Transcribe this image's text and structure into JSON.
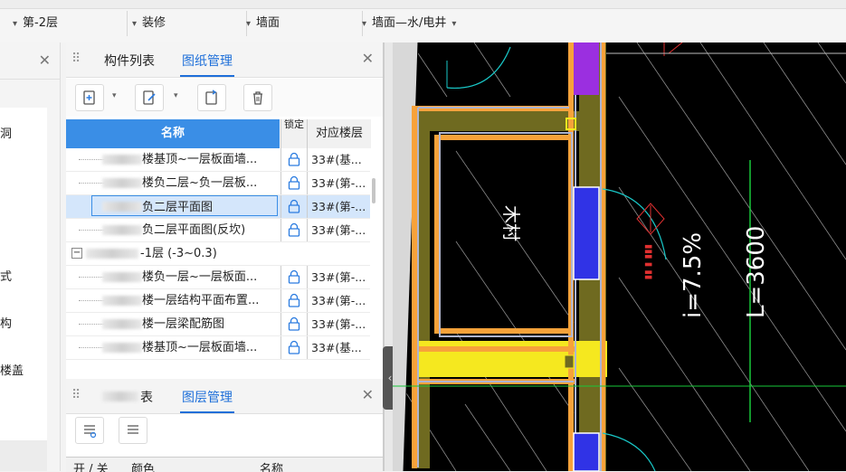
{
  "toolbar": {
    "combos": [
      {
        "label": "第-2层"
      },
      {
        "label": "装修"
      },
      {
        "label": "墙面"
      },
      {
        "label": "墙面—水/电井"
      }
    ]
  },
  "left_panel": {
    "items": [
      "洞",
      "式",
      "构",
      "楼盖"
    ]
  },
  "drawing_panel": {
    "tabs": [
      "构件列表",
      "图纸管理"
    ],
    "active_tab": "图纸管理",
    "table": {
      "headers": {
        "name": "名称",
        "lock": "锁定",
        "floor": "对应楼层"
      },
      "rows": [
        {
          "name": "楼基顶~一层板面墙...",
          "floor": "33#(基...",
          "selected": false
        },
        {
          "name": "楼负二层~负一层板...",
          "floor": "33#(第-...",
          "selected": false
        },
        {
          "name": "负二层平面图",
          "floor": "33#(第-...",
          "selected": true
        },
        {
          "name": "负二层平面图(反坎)",
          "floor": "33#(第-...",
          "selected": false
        },
        {
          "name": "-1层 (-3~0.3)",
          "floor": "",
          "group": true
        },
        {
          "name": "楼负一层~一层板面...",
          "floor": "33#(第-...",
          "selected": false
        },
        {
          "name": "楼一层结构平面布置...",
          "floor": "33#(第-...",
          "selected": false
        },
        {
          "name": "楼一层梁配筋图",
          "floor": "33#(第-...",
          "selected": false
        },
        {
          "name": "楼基顶~一层板面墙...",
          "floor": "33#(基...",
          "selected": false
        }
      ]
    }
  },
  "layer_panel": {
    "tabs": [
      "表",
      "图层管理"
    ],
    "active_tab": "图层管理",
    "headers": {
      "onoff": "开 / 关",
      "color": "颜色",
      "name": "名称"
    }
  },
  "cad": {
    "labels": {
      "material": "木村",
      "slope": "i=7.5%",
      "length": "L=3600"
    },
    "colors": {
      "wall": "#f7a23a",
      "fill": "#6f6a20",
      "door": "#3033e6",
      "purple": "#9b2fe0",
      "yellow": "#f5e81f",
      "cyan": "#19c8c8",
      "green": "#18c83a",
      "red": "#e03030"
    }
  }
}
